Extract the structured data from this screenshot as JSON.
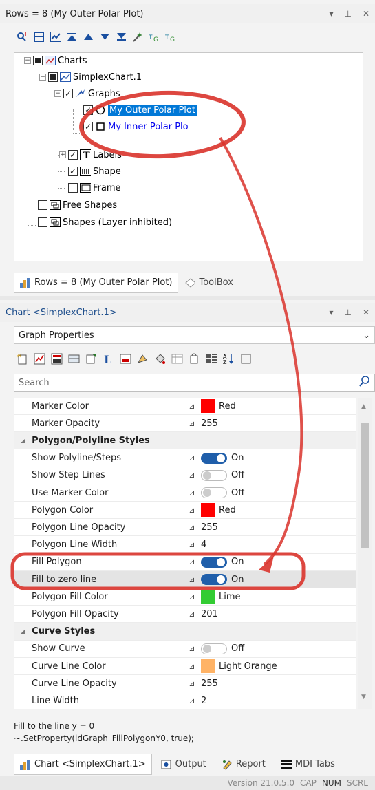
{
  "top_panel": {
    "title": "Rows = 8 (My Outer Polar Plot)",
    "toolbar_icons": [
      "search-plus-icon",
      "grid-icon",
      "chart-add-icon",
      "move-top-icon",
      "move-up-icon",
      "move-down-icon",
      "move-bottom-icon",
      "magic-wand-icon",
      "copy-style-icon",
      "paste-style-icon"
    ]
  },
  "tree": {
    "charts": "Charts",
    "simplex_chart": "SimplexChart.1",
    "graphs": "Graphs",
    "outer_plot": "My Outer Polar Plot",
    "inner_plot": "My Inner Polar Plo",
    "labels": "Labels",
    "shape": "Shape",
    "frame": "Frame",
    "free_shapes": "Free Shapes",
    "shapes_inhibited": "Shapes (Layer inhibited)"
  },
  "top_tabs": {
    "rows": "Rows = 8 (My Outer Polar Plot)",
    "toolbox": "ToolBox"
  },
  "prop_panel": {
    "title": "Chart <SimplexChart.1>",
    "combo_value": "Graph Properties",
    "search_placeholder": "Search"
  },
  "rows": [
    {
      "type": "prop",
      "name": "Marker Color",
      "kind": "color",
      "color": "#ff0000",
      "value": "Red"
    },
    {
      "type": "prop",
      "name": "Marker Opacity",
      "kind": "text",
      "value": "255"
    },
    {
      "type": "cat",
      "name": "Polygon/Polyline Styles"
    },
    {
      "type": "prop",
      "name": "Show Polyline/Steps",
      "kind": "toggle",
      "on": true,
      "value": "On"
    },
    {
      "type": "prop",
      "name": "Show Step Lines",
      "kind": "toggle",
      "on": false,
      "value": "Off"
    },
    {
      "type": "prop",
      "name": "Use Marker Color",
      "kind": "toggle",
      "on": false,
      "value": "Off"
    },
    {
      "type": "prop",
      "name": "Polygon Color",
      "kind": "color",
      "color": "#ff0000",
      "value": "Red"
    },
    {
      "type": "prop",
      "name": "Polygon Line Opacity",
      "kind": "text",
      "value": "255"
    },
    {
      "type": "prop",
      "name": "Polygon Line Width",
      "kind": "text",
      "value": "4"
    },
    {
      "type": "prop",
      "name": "Fill Polygon",
      "kind": "toggle",
      "on": true,
      "value": "On"
    },
    {
      "type": "prop",
      "name": "Fill to zero line",
      "kind": "toggle",
      "on": true,
      "value": "On",
      "selected": true
    },
    {
      "type": "prop",
      "name": "Polygon Fill Color",
      "kind": "color",
      "color": "#33cc33",
      "value": "Lime"
    },
    {
      "type": "prop",
      "name": "Polygon Fill Opacity",
      "kind": "text",
      "value": "201"
    },
    {
      "type": "cat",
      "name": "Curve Styles"
    },
    {
      "type": "prop",
      "name": "Show Curve",
      "kind": "toggle",
      "on": false,
      "value": "Off"
    },
    {
      "type": "prop",
      "name": "Curve Line Color",
      "kind": "color",
      "color": "#ffb366",
      "value": "Light Orange"
    },
    {
      "type": "prop",
      "name": "Curve Line Opacity",
      "kind": "text",
      "value": "255"
    },
    {
      "type": "prop",
      "name": "Line Width",
      "kind": "text",
      "value": "2"
    }
  ],
  "description": {
    "line1": "Fill to the line y = 0",
    "line2": "~.SetProperty(idGraph_FillPolygonY0, true);"
  },
  "bottom_tabs": {
    "chart": "Chart <SimplexChart.1>",
    "output": "Output",
    "report": "Report",
    "mdi": "MDI Tabs"
  },
  "status": {
    "version": "Version 21.0.5.0",
    "cap": "CAP",
    "num": "NUM",
    "scrl": "SCRL"
  },
  "colors": {
    "accent": "#0078d7",
    "toggle_on": "#1f5eaa",
    "annotation": "#d9332b"
  }
}
